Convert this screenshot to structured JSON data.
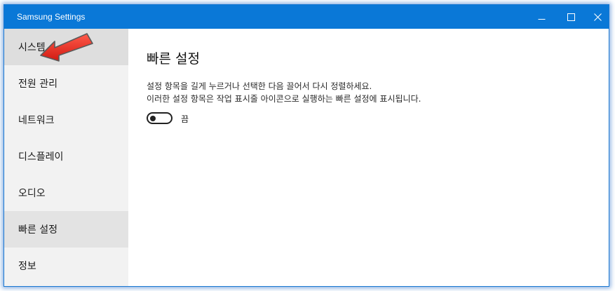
{
  "window": {
    "title": "Samsung Settings",
    "controls": {
      "minimize_icon": "minimize-icon",
      "maximize_icon": "maximize-icon",
      "close_icon": "close-icon"
    }
  },
  "sidebar": {
    "items": [
      {
        "label": "시스템",
        "state": "hover"
      },
      {
        "label": "전원 관리",
        "state": "normal"
      },
      {
        "label": "네트워크",
        "state": "normal"
      },
      {
        "label": "디스플레이",
        "state": "normal"
      },
      {
        "label": "오디오",
        "state": "normal"
      },
      {
        "label": "빠른 설정",
        "state": "selected"
      },
      {
        "label": "정보",
        "state": "normal"
      }
    ]
  },
  "main": {
    "title": "빠른 설정",
    "description_line1": "설정 항목을 길게 누르거나 선택한 다음 끌어서 다시 정렬하세요.",
    "description_line2": "이러한 설정 항목은 작업 표시줄 아이콘으로 실행하는 빠른 설정에 표시됩니다.",
    "toggle": {
      "state_label": "끔",
      "on": false
    }
  },
  "annotation": {
    "icon": "red-arrow-icon",
    "color": "#e8241c"
  },
  "colors": {
    "titlebar": "#0a78d7",
    "sidebar_bg": "#f2f2f2",
    "selected_bg": "#e3e3e3"
  }
}
